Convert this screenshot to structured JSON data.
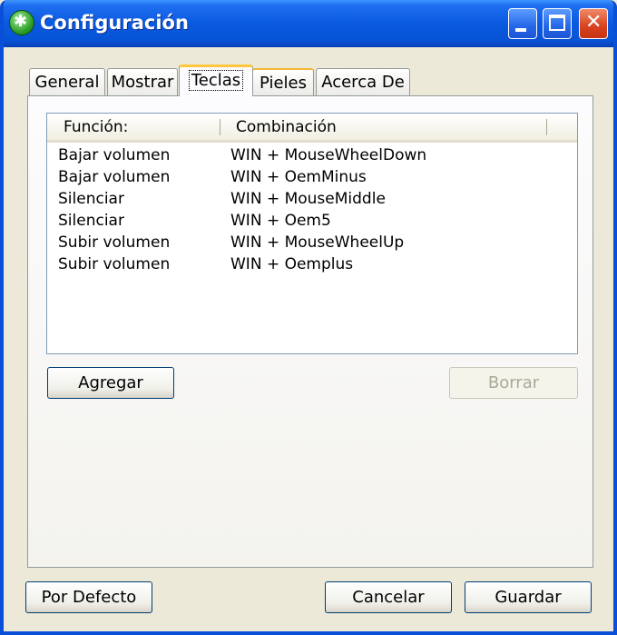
{
  "window": {
    "title": "Configuración"
  },
  "tabs": [
    {
      "label": "General"
    },
    {
      "label": "Mostrar"
    },
    {
      "label": "Teclas"
    },
    {
      "label": "Pieles"
    },
    {
      "label": "Acerca De"
    }
  ],
  "active_tab": "Teclas",
  "hotkeys": {
    "columns": [
      "Función:",
      "Combinación"
    ],
    "rows": [
      {
        "function": "Bajar volumen",
        "combination": "WIN + MouseWheelDown"
      },
      {
        "function": "Bajar volumen",
        "combination": "WIN + OemMinus"
      },
      {
        "function": "Silenciar",
        "combination": "WIN + MouseMiddle"
      },
      {
        "function": "Silenciar",
        "combination": "WIN + Oem5"
      },
      {
        "function": "Subir volumen",
        "combination": "WIN + MouseWheelUp"
      },
      {
        "function": "Subir volumen",
        "combination": "WIN + Oemplus"
      }
    ]
  },
  "buttons": {
    "add": "Agregar",
    "delete": "Borrar",
    "defaults": "Por Defecto",
    "cancel": "Cancelar",
    "save": "Guardar"
  },
  "colors": {
    "titlebar": "#0a5ae0",
    "tab_highlight": "#ffc83c",
    "face": "#ece9d8"
  }
}
